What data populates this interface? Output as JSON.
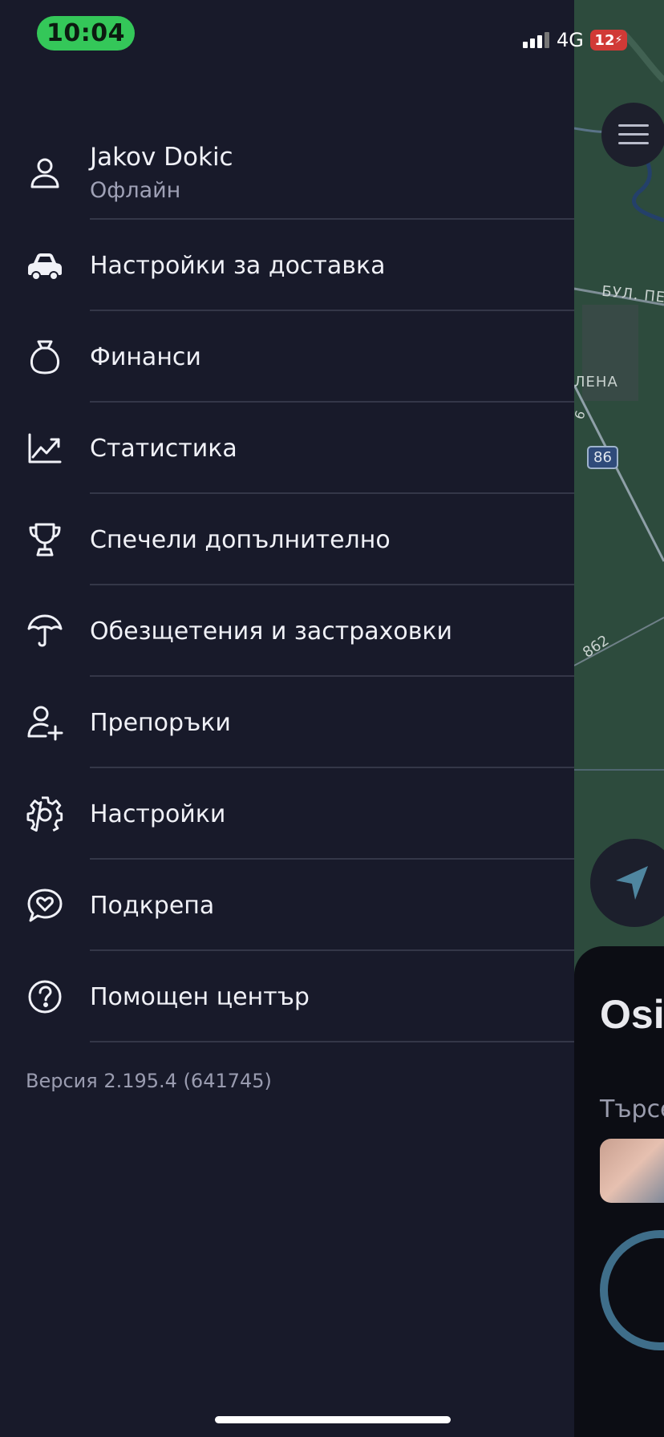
{
  "status_bar": {
    "time": "10:04",
    "network": "4G",
    "battery": "12"
  },
  "profile": {
    "name": "Jakov Dokic",
    "status": "Офлайн"
  },
  "menu": [
    {
      "label": "Настройки за доставка",
      "icon": "car-icon"
    },
    {
      "label": "Финанси",
      "icon": "money-bag-icon"
    },
    {
      "label": "Статистика",
      "icon": "chart-icon"
    },
    {
      "label": "Спечели допълнително",
      "icon": "trophy-icon"
    },
    {
      "label": "Обезщетения и застраховки",
      "icon": "umbrella-icon"
    },
    {
      "label": "Препоръки",
      "icon": "add-user-icon"
    },
    {
      "label": "Настройки",
      "icon": "gear-icon"
    },
    {
      "label": "Подкрепа",
      "icon": "heart-chat-icon"
    },
    {
      "label": "Помощен център",
      "icon": "help-icon"
    }
  ],
  "version": "Версия 2.195.4 (641745)",
  "map": {
    "road_label": "БУЛ. ПЕЩ",
    "district_label": "ЛЕНА",
    "road_number_1": "86",
    "road_number_2": "862",
    "road_number_3": "6",
    "panel_title": "Osi",
    "panel_subtitle": "Търсе"
  },
  "colors": {
    "background": "#181a2a",
    "time_pill": "#34c759",
    "divider": "#343748",
    "map_green": "#2b4a3c"
  }
}
